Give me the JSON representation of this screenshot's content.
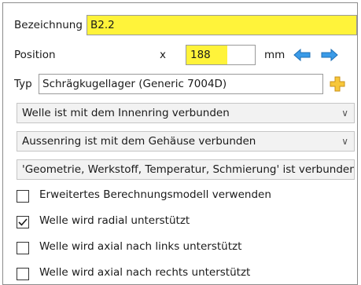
{
  "form": {
    "bezeichnung_label": "Bezeichnung",
    "bezeichnung_value": "B2.2",
    "position_label": "Position",
    "position_axis": "x",
    "position_value": "188",
    "position_unit": "mm",
    "typ_label": "Typ",
    "typ_value": "Schrägkugellager (Generic 7004D)"
  },
  "dropdowns": {
    "welle": "Welle ist mit dem Innenring verbunden",
    "aussenring": "Aussenring ist mit dem Gehäuse verbunden",
    "eigenschaften": "'Geometrie, Werkstoff, Temperatur, Schmierung' ist verbunden"
  },
  "checkboxes": [
    {
      "label": "Erweitertes Berechnungsmodell verwenden",
      "checked": false
    },
    {
      "label": "Welle wird radial unterstützt",
      "checked": true
    },
    {
      "label": "Welle wird axial nach links unterstützt",
      "checked": false
    },
    {
      "label": "Welle wird axial nach rechts unterstützt",
      "checked": false
    }
  ],
  "icons": {
    "left": "arrow-left-icon",
    "right": "arrow-right-icon",
    "add": "plus-icon",
    "chevron": "chevron-down-icon"
  },
  "colors": {
    "highlight": "#fff33a",
    "arrow_blue": "#3a9be8",
    "plus_yellow": "#f7c73a"
  }
}
